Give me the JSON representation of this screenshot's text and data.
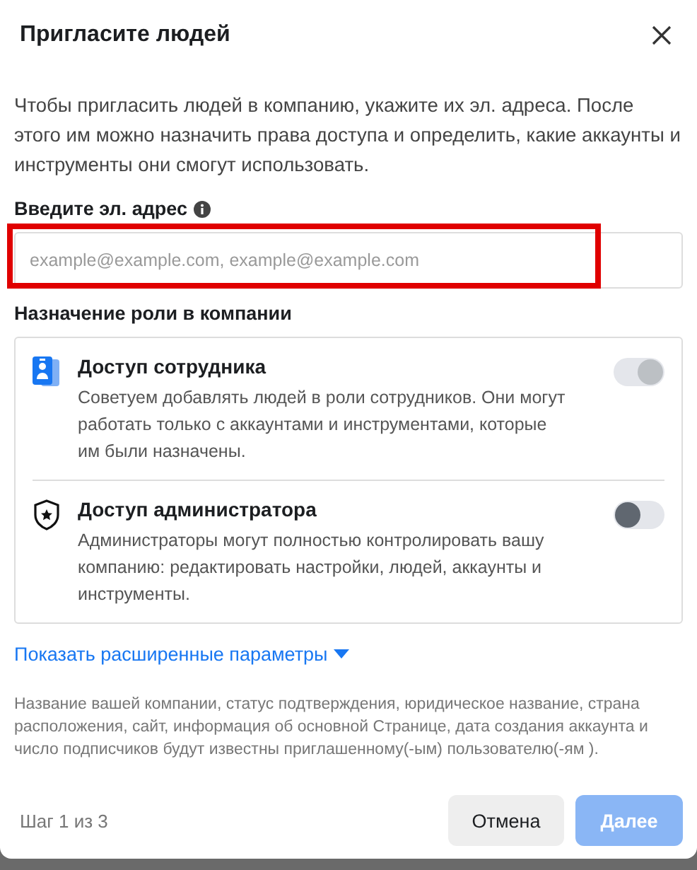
{
  "dialog": {
    "title": "Пригласите людей",
    "intro": "Чтобы пригласить людей в компанию, укажите их эл. адреса. После этого им можно назначить права доступа и определить, какие аккаунты и инструменты они смогут использовать."
  },
  "email": {
    "label": "Введите эл. адрес",
    "placeholder": "example@example.com, example@example.com",
    "highlighted": true
  },
  "roles": {
    "heading": "Назначение роли в компании",
    "items": [
      {
        "kind": "employee",
        "title": "Доступ сотрудника",
        "description": "Советуем добавлять людей в роли сотрудников. Они могут работать только с аккаунтами и инструментами, которые им были назначены.",
        "on": true,
        "disabled": true
      },
      {
        "kind": "admin",
        "title": "Доступ администратора",
        "description": "Администраторы могут полностью контролировать вашу компанию: редактировать настройки, людей, аккаунты и инструменты.",
        "on": false,
        "disabled": false
      }
    ]
  },
  "advanced_link": "Показать расширенные параметры",
  "disclosure": "Название вашей компании, статус подтверждения, юридическое название, страна расположения, сайт, информация об основной Странице, дата создания аккаунта и число подписчиков будут известны приглашенному(-ым) пользователю(-ям ).",
  "footer": {
    "step": "Шаг 1 из 3",
    "buttons": [
      {
        "label": "Отмена",
        "kind": "secondary",
        "disabled": false
      },
      {
        "label": "Далее",
        "kind": "primary",
        "disabled": true
      }
    ]
  }
}
